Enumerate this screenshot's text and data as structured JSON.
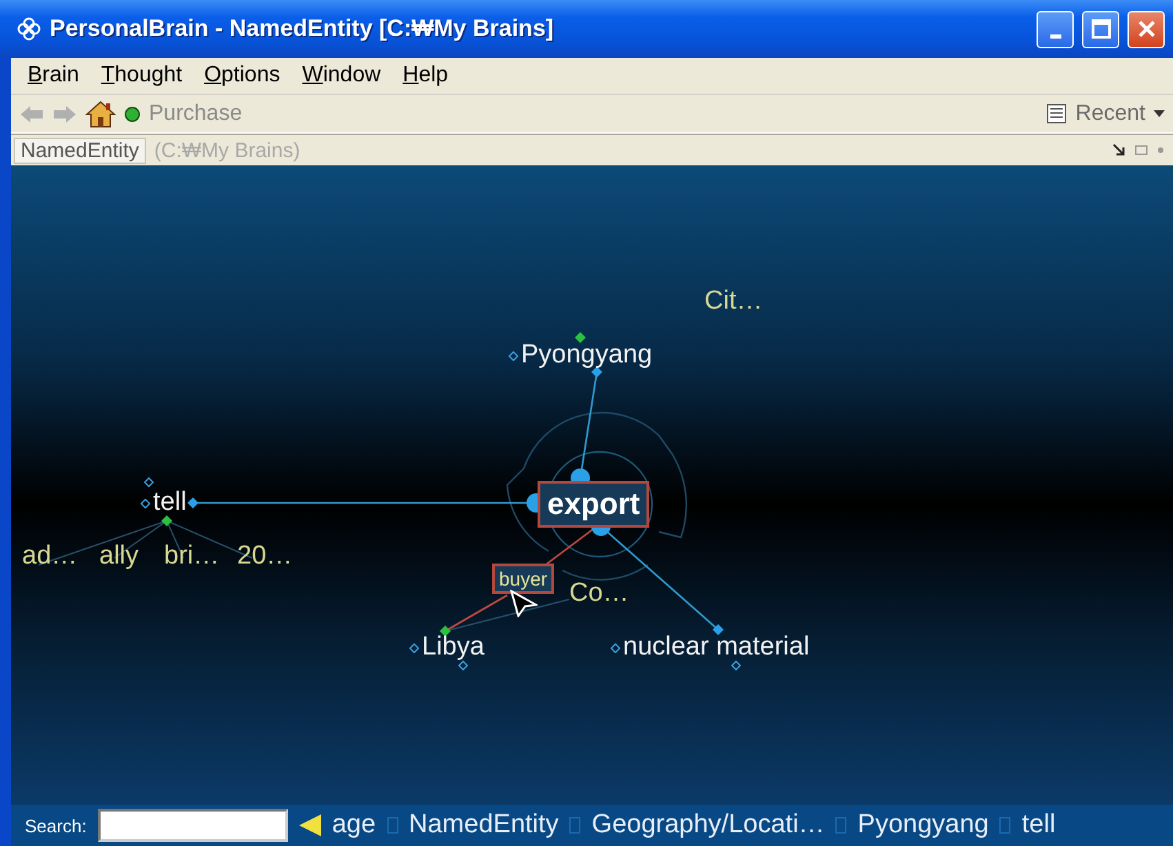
{
  "window": {
    "title": "PersonalBrain - NamedEntity [C:₩My Brains]"
  },
  "menu": [
    "Brain",
    "Thought",
    "Options",
    "Window",
    "Help"
  ],
  "toolbar": {
    "active_thought": "Purchase",
    "recent": "Recent"
  },
  "path_bar": {
    "brain": "NamedEntity",
    "location": "(C:₩My Brains)"
  },
  "graph": {
    "nodes": [
      {
        "label": "Cit…",
        "kind": "folded"
      },
      {
        "label": "Pyongyang",
        "kind": "thought"
      },
      {
        "label": "tell",
        "kind": "thought"
      },
      {
        "label": "export",
        "kind": "central"
      },
      {
        "label": "ad…",
        "kind": "folded"
      },
      {
        "label": "ally",
        "kind": "folded"
      },
      {
        "label": "bri…",
        "kind": "folded"
      },
      {
        "label": "20…",
        "kind": "folded"
      },
      {
        "label": "buyer",
        "kind": "link_label"
      },
      {
        "label": "Co…",
        "kind": "folded"
      },
      {
        "label": "Libya",
        "kind": "thought"
      },
      {
        "label": "nuclear material",
        "kind": "thought"
      }
    ]
  },
  "bottom_bar": {
    "search_label": "Search:",
    "past_thoughts": [
      "age",
      "NamedEntity",
      "Geography/Locati…",
      "Pyongyang",
      "tell"
    ]
  }
}
